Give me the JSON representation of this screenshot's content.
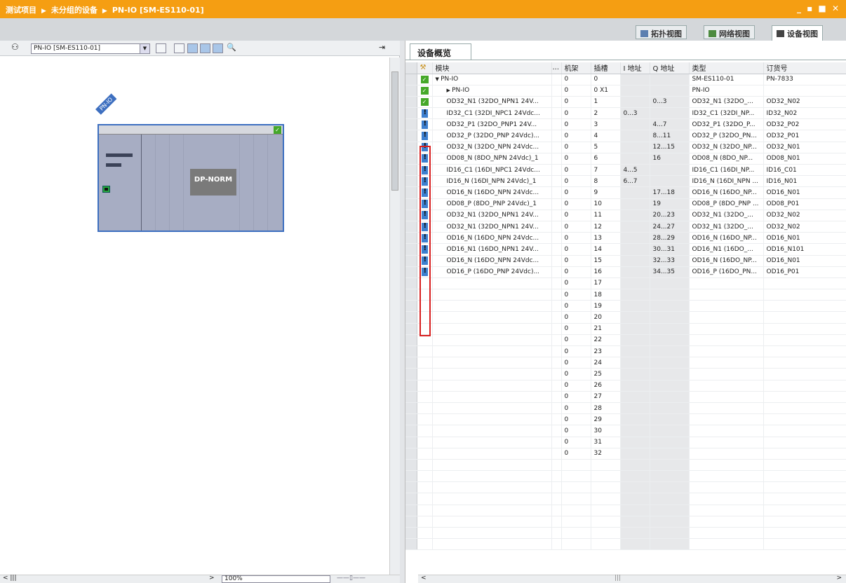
{
  "titlebar": {
    "crumbs": [
      "测试项目",
      "未分组的设备",
      "PN-IO [SM-ES110-01]"
    ],
    "controls": "_ ▪ ■ ✕"
  },
  "view_tabs": [
    "拓扑视图",
    "网络视图",
    "设备视图"
  ],
  "left_toolbar": {
    "device_select": "PN-IO [SM-ES110-01]"
  },
  "device": {
    "label": "PN-IO",
    "module": "DP-NORM"
  },
  "zoom": "100%",
  "right_tab": "设备概览",
  "columns": [
    "模块",
    "...",
    "机架",
    "插槽",
    "I 地址",
    "Q 地址",
    "类型",
    "订货号"
  ],
  "rows": [
    {
      "status": "ok",
      "indent": 0,
      "expand": "▼",
      "module": "PN-IO",
      "rack": "0",
      "slot": "0",
      "i": "",
      "q": "",
      "type": "SM-ES110-01",
      "order": "PN-7833"
    },
    {
      "status": "ok",
      "indent": 1,
      "expand": "▶",
      "module": "PN-IO",
      "rack": "0",
      "slot": "0 X1",
      "i": "",
      "q": "",
      "type": "PN-IO",
      "order": ""
    },
    {
      "status": "ok",
      "indent": 1,
      "expand": "",
      "module": "OD32_N1 (32DO_NPN1 24V...",
      "rack": "0",
      "slot": "1",
      "i": "",
      "q": "0...3",
      "type": "OD32_N1 (32DO_...",
      "order": "OD32_N02"
    },
    {
      "status": "err",
      "indent": 1,
      "expand": "",
      "module": "ID32_C1 (32DI_NPC1 24Vdc...",
      "rack": "0",
      "slot": "2",
      "i": "0...3",
      "q": "",
      "type": "ID32_C1 (32DI_NP...",
      "order": "ID32_N02"
    },
    {
      "status": "err",
      "indent": 1,
      "expand": "",
      "module": "OD32_P1 (32DO_PNP1 24V...",
      "rack": "0",
      "slot": "3",
      "i": "",
      "q": "4...7",
      "type": "OD32_P1 (32DO_P...",
      "order": "OD32_P02"
    },
    {
      "status": "err",
      "indent": 1,
      "expand": "",
      "module": "OD32_P (32DO_PNP 24Vdc)...",
      "rack": "0",
      "slot": "4",
      "i": "",
      "q": "8...11",
      "type": "OD32_P (32DO_PN...",
      "order": "OD32_P01"
    },
    {
      "status": "err",
      "indent": 1,
      "expand": "",
      "module": "OD32_N (32DO_NPN 24Vdc...",
      "rack": "0",
      "slot": "5",
      "i": "",
      "q": "12...15",
      "type": "OD32_N (32DO_NP...",
      "order": "OD32_N01"
    },
    {
      "status": "err",
      "indent": 1,
      "expand": "",
      "module": "OD08_N (8DO_NPN 24Vdc)_1",
      "rack": "0",
      "slot": "6",
      "i": "",
      "q": "16",
      "type": "OD08_N (8DO_NP...",
      "order": "OD08_N01"
    },
    {
      "status": "err",
      "indent": 1,
      "expand": "",
      "module": "ID16_C1 (16DI_NPC1 24Vdc...",
      "rack": "0",
      "slot": "7",
      "i": "4...5",
      "q": "",
      "type": "ID16_C1 (16DI_NP...",
      "order": "ID16_C01"
    },
    {
      "status": "err",
      "indent": 1,
      "expand": "",
      "module": "ID16_N (16DI_NPN 24Vdc)_1",
      "rack": "0",
      "slot": "8",
      "i": "6...7",
      "q": "",
      "type": "ID16_N (16DI_NPN ...",
      "order": "ID16_N01"
    },
    {
      "status": "err",
      "indent": 1,
      "expand": "",
      "module": "OD16_N (16DO_NPN 24Vdc...",
      "rack": "0",
      "slot": "9",
      "i": "",
      "q": "17...18",
      "type": "OD16_N (16DO_NP...",
      "order": "OD16_N01"
    },
    {
      "status": "err",
      "indent": 1,
      "expand": "",
      "module": "OD08_P (8DO_PNP 24Vdc)_1",
      "rack": "0",
      "slot": "10",
      "i": "",
      "q": "19",
      "type": "OD08_P (8DO_PNP ...",
      "order": "OD08_P01"
    },
    {
      "status": "err",
      "indent": 1,
      "expand": "",
      "module": "OD32_N1 (32DO_NPN1 24V...",
      "rack": "0",
      "slot": "11",
      "i": "",
      "q": "20...23",
      "type": "OD32_N1 (32DO_...",
      "order": "OD32_N02"
    },
    {
      "status": "err",
      "indent": 1,
      "expand": "",
      "module": "OD32_N1 (32DO_NPN1 24V...",
      "rack": "0",
      "slot": "12",
      "i": "",
      "q": "24...27",
      "type": "OD32_N1 (32DO_...",
      "order": "OD32_N02"
    },
    {
      "status": "err",
      "indent": 1,
      "expand": "",
      "module": "OD16_N (16DO_NPN 24Vdc...",
      "rack": "0",
      "slot": "13",
      "i": "",
      "q": "28...29",
      "type": "OD16_N (16DO_NP...",
      "order": "OD16_N01"
    },
    {
      "status": "err",
      "indent": 1,
      "expand": "",
      "module": "OD16_N1 (16DO_NPN1 24V...",
      "rack": "0",
      "slot": "14",
      "i": "",
      "q": "30...31",
      "type": "OD16_N1 (16DO_...",
      "order": "OD16_N101"
    },
    {
      "status": "err",
      "indent": 1,
      "expand": "",
      "module": "OD16_N (16DO_NPN 24Vdc...",
      "rack": "0",
      "slot": "15",
      "i": "",
      "q": "32...33",
      "type": "OD16_N (16DO_NP...",
      "order": "OD16_N01"
    },
    {
      "status": "err",
      "indent": 1,
      "expand": "",
      "module": "OD16_P (16DO_PNP 24Vdc)...",
      "rack": "0",
      "slot": "16",
      "i": "",
      "q": "34...35",
      "type": "OD16_P (16DO_PN...",
      "order": "OD16_P01"
    },
    {
      "status": "",
      "indent": 0,
      "expand": "",
      "module": "",
      "rack": "0",
      "slot": "17",
      "i": "",
      "q": "",
      "type": "",
      "order": ""
    },
    {
      "status": "",
      "indent": 0,
      "expand": "",
      "module": "",
      "rack": "0",
      "slot": "18",
      "i": "",
      "q": "",
      "type": "",
      "order": ""
    },
    {
      "status": "",
      "indent": 0,
      "expand": "",
      "module": "",
      "rack": "0",
      "slot": "19",
      "i": "",
      "q": "",
      "type": "",
      "order": ""
    },
    {
      "status": "",
      "indent": 0,
      "expand": "",
      "module": "",
      "rack": "0",
      "slot": "20",
      "i": "",
      "q": "",
      "type": "",
      "order": ""
    },
    {
      "status": "",
      "indent": 0,
      "expand": "",
      "module": "",
      "rack": "0",
      "slot": "21",
      "i": "",
      "q": "",
      "type": "",
      "order": ""
    },
    {
      "status": "",
      "indent": 0,
      "expand": "",
      "module": "",
      "rack": "0",
      "slot": "22",
      "i": "",
      "q": "",
      "type": "",
      "order": ""
    },
    {
      "status": "",
      "indent": 0,
      "expand": "",
      "module": "",
      "rack": "0",
      "slot": "23",
      "i": "",
      "q": "",
      "type": "",
      "order": ""
    },
    {
      "status": "",
      "indent": 0,
      "expand": "",
      "module": "",
      "rack": "0",
      "slot": "24",
      "i": "",
      "q": "",
      "type": "",
      "order": ""
    },
    {
      "status": "",
      "indent": 0,
      "expand": "",
      "module": "",
      "rack": "0",
      "slot": "25",
      "i": "",
      "q": "",
      "type": "",
      "order": ""
    },
    {
      "status": "",
      "indent": 0,
      "expand": "",
      "module": "",
      "rack": "0",
      "slot": "26",
      "i": "",
      "q": "",
      "type": "",
      "order": ""
    },
    {
      "status": "",
      "indent": 0,
      "expand": "",
      "module": "",
      "rack": "0",
      "slot": "27",
      "i": "",
      "q": "",
      "type": "",
      "order": ""
    },
    {
      "status": "",
      "indent": 0,
      "expand": "",
      "module": "",
      "rack": "0",
      "slot": "28",
      "i": "",
      "q": "",
      "type": "",
      "order": ""
    },
    {
      "status": "",
      "indent": 0,
      "expand": "",
      "module": "",
      "rack": "0",
      "slot": "29",
      "i": "",
      "q": "",
      "type": "",
      "order": ""
    },
    {
      "status": "",
      "indent": 0,
      "expand": "",
      "module": "",
      "rack": "0",
      "slot": "30",
      "i": "",
      "q": "",
      "type": "",
      "order": ""
    },
    {
      "status": "",
      "indent": 0,
      "expand": "",
      "module": "",
      "rack": "0",
      "slot": "31",
      "i": "",
      "q": "",
      "type": "",
      "order": ""
    },
    {
      "status": "",
      "indent": 0,
      "expand": "",
      "module": "",
      "rack": "0",
      "slot": "32",
      "i": "",
      "q": "",
      "type": "",
      "order": ""
    }
  ],
  "empty_rows": 8,
  "colors": {
    "titlebar": "#f59e12",
    "ok": "#45a829",
    "error_icon": "#3d7fcf",
    "highlight": "#d82020",
    "rack_border": "#3d6fc0"
  }
}
